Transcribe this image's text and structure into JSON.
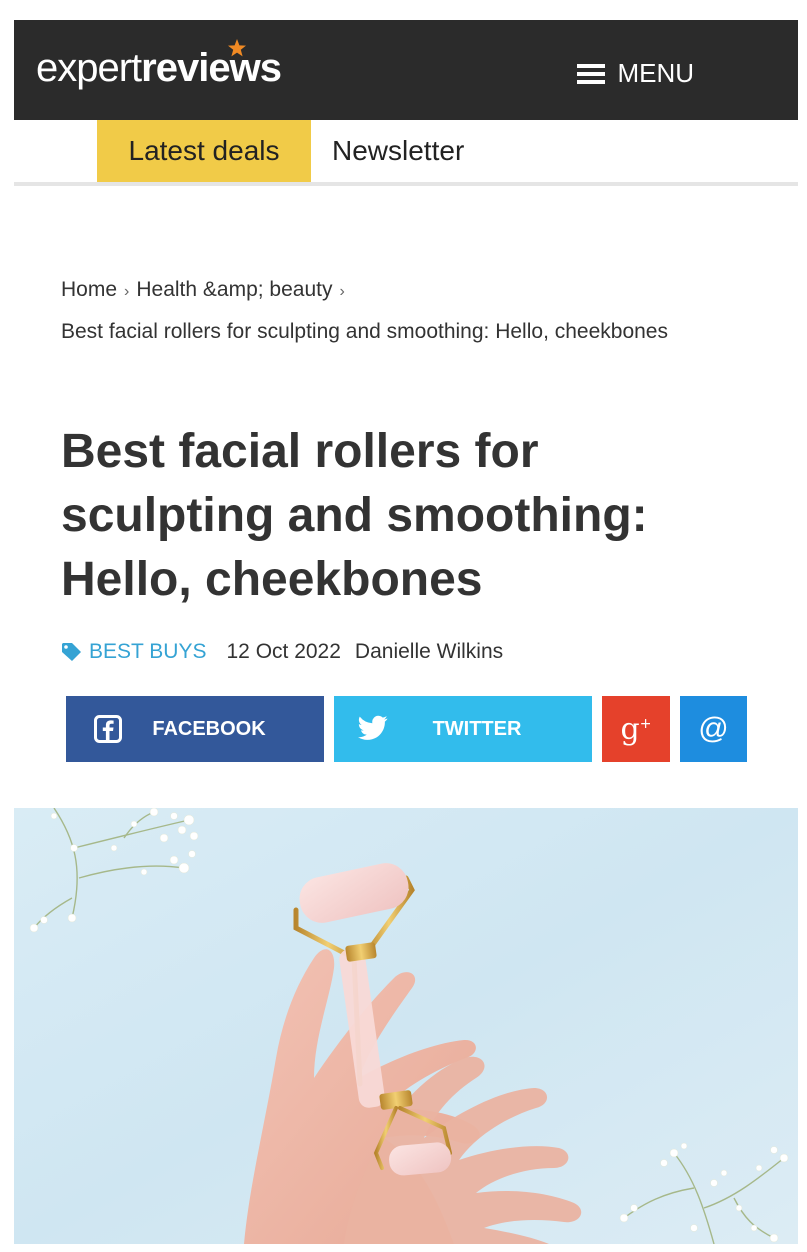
{
  "header": {
    "logo_light": "expert",
    "logo_bold": "reviews",
    "menu_label": "MENU",
    "menu_icon": "hamburger-icon"
  },
  "nav": {
    "deals_label": "Latest deals",
    "newsletter_label": "Newsletter"
  },
  "breadcrumb": {
    "items": [
      "Home",
      "Health &amp; beauty"
    ],
    "current": "Best facial rollers for sculpting and smoothing: Hello, cheekbones"
  },
  "article": {
    "title": "Best facial rollers for sculpting and smoothing: Hello, cheekbones",
    "category": "BEST BUYS",
    "category_icon": "tag-icon",
    "date": "12 Oct 2022",
    "author": "Danielle Wilkins"
  },
  "share": {
    "facebook_label": "FACEBOOK",
    "twitter_label": "TWITTER",
    "googleplus_label": "g+",
    "email_label": "@"
  },
  "colors": {
    "topbar": "#2b2b2b",
    "accent_star": "#f08a24",
    "deals_bg": "#f1cb48",
    "category": "#35a3d4",
    "facebook": "#33589a",
    "twitter": "#32bcec",
    "googleplus": "#e5412b",
    "email": "#1e8ddf"
  }
}
